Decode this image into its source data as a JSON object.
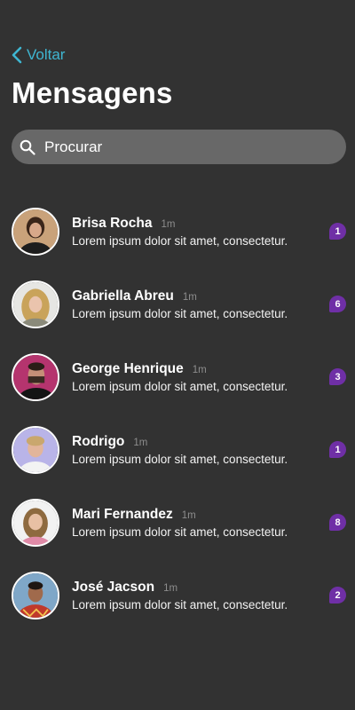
{
  "header": {
    "back_label": "Voltar",
    "title": "Mensagens"
  },
  "search": {
    "placeholder": "Procurar"
  },
  "colors": {
    "background": "#323232",
    "accent": "#3fb6d1",
    "badge": "#6f2fa6",
    "search_bg": "#686868"
  },
  "conversations": [
    {
      "name": "Brisa Rocha",
      "time": "1m",
      "preview": "Lorem ipsum dolor sit amet, consectetur.",
      "unread": "1",
      "avatar": "avatar-photo"
    },
    {
      "name": "Gabriella Abreu",
      "time": "1m",
      "preview": "Lorem ipsum dolor sit amet, consectetur.",
      "unread": "6",
      "avatar": "avatar-photo"
    },
    {
      "name": "George Henrique",
      "time": "1m",
      "preview": "Lorem ipsum dolor sit amet, consectetur.",
      "unread": "3",
      "avatar": "avatar-photo"
    },
    {
      "name": "Rodrigo",
      "time": "1m",
      "preview": "Lorem ipsum dolor sit amet, consectetur.",
      "unread": "1",
      "avatar": "avatar-photo"
    },
    {
      "name": "Mari Fernandez",
      "time": "1m",
      "preview": "Lorem ipsum dolor sit amet, consectetur.",
      "unread": "8",
      "avatar": "avatar-photo"
    },
    {
      "name": "José Jacson",
      "time": "1m",
      "preview": "Lorem ipsum dolor sit amet, consectetur.",
      "unread": "2",
      "avatar": "avatar-photo"
    }
  ]
}
